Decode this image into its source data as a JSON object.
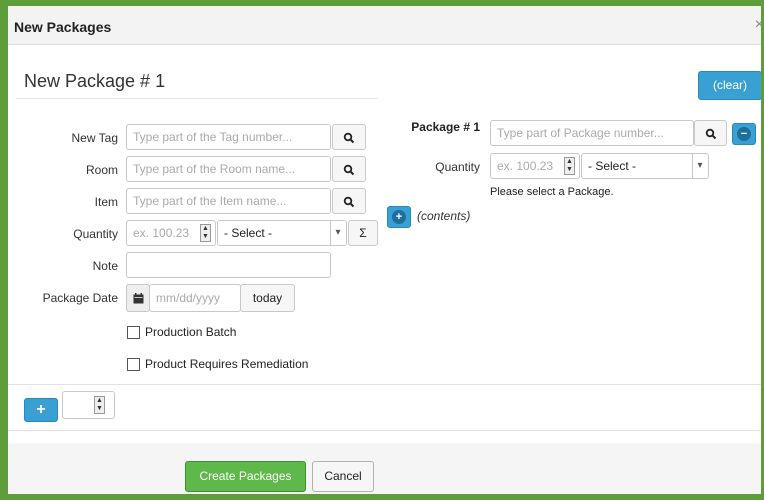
{
  "window": {
    "title": "New Packages",
    "close_icon": "×"
  },
  "header": {
    "title": "New Package # 1",
    "clear_label": "(clear)"
  },
  "left": {
    "new_tag": {
      "label": "New Tag",
      "placeholder": "Type part of the Tag number..."
    },
    "room": {
      "label": "Room",
      "placeholder": "Type part of the Room name..."
    },
    "item": {
      "label": "Item",
      "placeholder": "Type part of the Item name..."
    },
    "quantity": {
      "label": "Quantity",
      "placeholder": "ex. 100.23",
      "unit_select": "- Select -",
      "sum_label": "Σ"
    },
    "note": {
      "label": "Note",
      "value": ""
    },
    "package_date": {
      "label": "Package Date",
      "placeholder": "mm/dd/yyyy",
      "today_label": "today"
    },
    "production_batch": {
      "label": "Production Batch",
      "checked": false
    },
    "remediation": {
      "label": "Product Requires Remediation",
      "checked": false
    }
  },
  "right": {
    "package": {
      "label": "Package # 1",
      "placeholder": "Type part of Package number..."
    },
    "quantity": {
      "label": "Quantity",
      "placeholder": "ex. 100.23",
      "unit_select": "- Select -"
    },
    "hint": "Please select a Package.",
    "contents_label": "(contents)"
  },
  "add_row": {
    "plus": "+",
    "count": ""
  },
  "footer": {
    "create_label": "Create Packages",
    "cancel_label": "Cancel"
  },
  "colors": {
    "accent": "#39a0d3",
    "primary": "#5fb84a",
    "border": "#5e9e3a"
  }
}
